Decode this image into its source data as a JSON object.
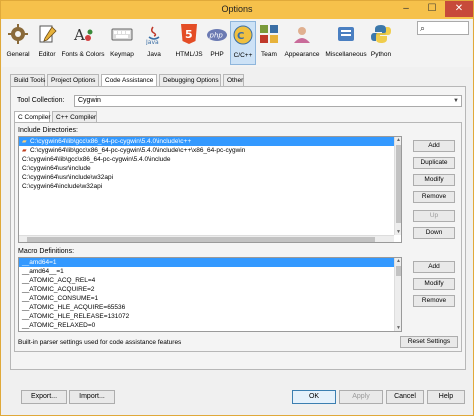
{
  "window": {
    "title": "Options"
  },
  "categories": [
    {
      "label": "General",
      "icon": "gear-icon",
      "color": "#8a6a3a"
    },
    {
      "label": "Editor",
      "icon": "editor-icon",
      "color": "#555555"
    },
    {
      "label": "Fonts & Colors",
      "icon": "palette-icon",
      "color": "#d04040"
    },
    {
      "label": "Keymap",
      "icon": "keyboard-icon",
      "color": "#666666"
    },
    {
      "label": "Java",
      "icon": "java-icon",
      "color": "#c0392b"
    },
    {
      "label": "HTML/JS",
      "icon": "html5-icon",
      "color": "#e44d26"
    },
    {
      "label": "PHP",
      "icon": "php-icon",
      "color": "#6b7ab3"
    },
    {
      "label": "C/C++",
      "icon": "cpp-icon",
      "color": "#3a6ea5"
    },
    {
      "label": "Team",
      "icon": "team-icon",
      "color": "#7a9a3a"
    },
    {
      "label": "Appearance",
      "icon": "appearance-icon",
      "color": "#c96b9a"
    },
    {
      "label": "Miscellaneous",
      "icon": "misc-icon",
      "color": "#4a7fc1"
    },
    {
      "label": "Python",
      "icon": "python-icon",
      "color": "#3c78aa"
    }
  ],
  "active_category": "C/C++",
  "tabs": [
    "Build Tools",
    "Project Options",
    "Code Assistance",
    "Debugging Options",
    "Other"
  ],
  "active_tab": "Code Assistance",
  "tool_collection": {
    "label": "Tool Collection:",
    "value": "Cygwin"
  },
  "subtabs": [
    "C Compiler",
    "C++ Compiler"
  ],
  "include": {
    "label": "Include Directories:",
    "items": [
      "C:\\cygwin64\\lib\\gcc\\x86_64-pc-cygwin\\5.4.0\\include\\c++",
      "C:\\cygwin64\\lib\\gcc\\x86_64-pc-cygwin\\5.4.0\\include\\c++\\x86_64-pc-cygwin",
      "C:\\cygwin64\\lib\\gcc\\x86_64-pc-cygwin\\5.4.0\\include",
      "C:\\cygwin64\\usr\\include",
      "C:\\cygwin64\\usr\\include\\w32api",
      "C:\\cygwin64\\include\\w32api"
    ],
    "buttons": {
      "add": "Add",
      "duplicate": "Duplicate",
      "modify": "Modify",
      "remove": "Remove",
      "up": "Up",
      "down": "Down"
    }
  },
  "macro": {
    "label": "Macro Definitions:",
    "items": [
      "__amd64=1",
      "__amd64__=1",
      "__ATOMIC_ACQ_REL=4",
      "__ATOMIC_ACQUIRE=2",
      "__ATOMIC_CONSUME=1",
      "__ATOMIC_HLE_ACQUIRE=65536",
      "__ATOMIC_HLE_RELEASE=131072",
      "__ATOMIC_RELAXED=0"
    ],
    "buttons": {
      "add": "Add",
      "modify": "Modify",
      "remove": "Remove"
    }
  },
  "note": "Built-in parser settings used for code assistance features",
  "reset": "Reset Settings",
  "footer": {
    "export": "Export...",
    "import": "Import...",
    "ok": "OK",
    "apply": "Apply",
    "cancel": "Cancel",
    "help": "Help"
  },
  "colors": {
    "selection": "#3399ff",
    "titlebar": "#f6c14b",
    "close": "#c74a3a"
  }
}
